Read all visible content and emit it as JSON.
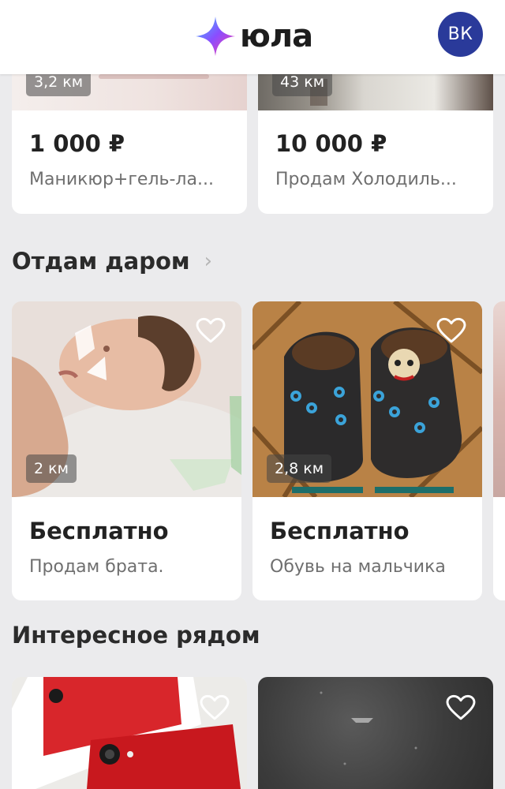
{
  "header": {
    "logo_text": "юла",
    "avatar_label": "ВК"
  },
  "top_cards": [
    {
      "distance": "3,2 км",
      "price": "1 000 ₽",
      "title": "Маникюр+гель-ла..."
    },
    {
      "distance": "43 км",
      "price": "10 000 ₽",
      "title": "Продам Холодиль..."
    }
  ],
  "sections": {
    "free": {
      "title": "Отдам даром",
      "chevron": "›"
    },
    "nearby": {
      "title": "Интересное рядом"
    }
  },
  "free_cards": [
    {
      "distance": "2 км",
      "price": "Бесплатно",
      "title": "Продам брата."
    },
    {
      "distance": "2,8 км",
      "price": "Бесплатно",
      "title": "Обувь на мальчика"
    }
  ],
  "colors": {
    "background": "#ebebed",
    "vk_badge": "#2a3a9a",
    "logo_gradient": [
      "#3fc6ff",
      "#8a4dff",
      "#ff3ea5"
    ]
  }
}
